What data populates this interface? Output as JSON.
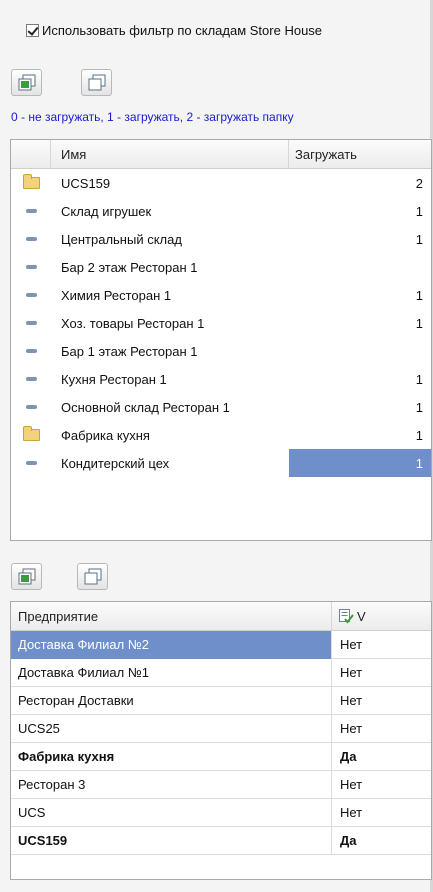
{
  "filter": {
    "checked": true,
    "label": "Использовать фильтр по складам Store House"
  },
  "hint": "0 - не загружать, 1 - загружать, 2 - загружать папку",
  "warehouses": {
    "columns": {
      "name": "Имя",
      "load": "Загружать"
    },
    "rows": [
      {
        "type": "folder",
        "name": "UCS159",
        "load": "2"
      },
      {
        "type": "item",
        "name": "Склад игрушек",
        "load": "1"
      },
      {
        "type": "item",
        "name": "Центральный склад",
        "load": "1"
      },
      {
        "type": "item",
        "name": "Бар 2 этаж Ресторан 1",
        "load": ""
      },
      {
        "type": "item",
        "name": "Химия Ресторан 1",
        "load": "1"
      },
      {
        "type": "item",
        "name": "Хоз. товары Ресторан 1",
        "load": "1"
      },
      {
        "type": "item",
        "name": "Бар 1 этаж Ресторан 1",
        "load": ""
      },
      {
        "type": "item",
        "name": "Кухня Ресторан 1",
        "load": "1"
      },
      {
        "type": "item",
        "name": "Основной склад Ресторан 1",
        "load": "1"
      },
      {
        "type": "folder",
        "name": "Фабрика кухня",
        "load": "1"
      },
      {
        "type": "item",
        "name": "Кондитерский цех",
        "load": "1",
        "selected": "value"
      }
    ]
  },
  "enterprises": {
    "columns": {
      "name": "Предприятие",
      "v": "V"
    },
    "rows": [
      {
        "name": "Доставка Филиал №2",
        "v": "Нет",
        "bold": false,
        "selected": "name"
      },
      {
        "name": "Доставка Филиал №1",
        "v": "Нет",
        "bold": false
      },
      {
        "name": "Ресторан Доставки",
        "v": "Нет",
        "bold": false
      },
      {
        "name": "UCS25",
        "v": "Нет",
        "bold": false
      },
      {
        "name": "Фабрика кухня",
        "v": "Да",
        "bold": true
      },
      {
        "name": "Ресторан 3",
        "v": "Нет",
        "bold": false
      },
      {
        "name": "UCS",
        "v": "Нет",
        "bold": false
      },
      {
        "name": "UCS159",
        "v": "Да",
        "bold": true
      }
    ]
  }
}
